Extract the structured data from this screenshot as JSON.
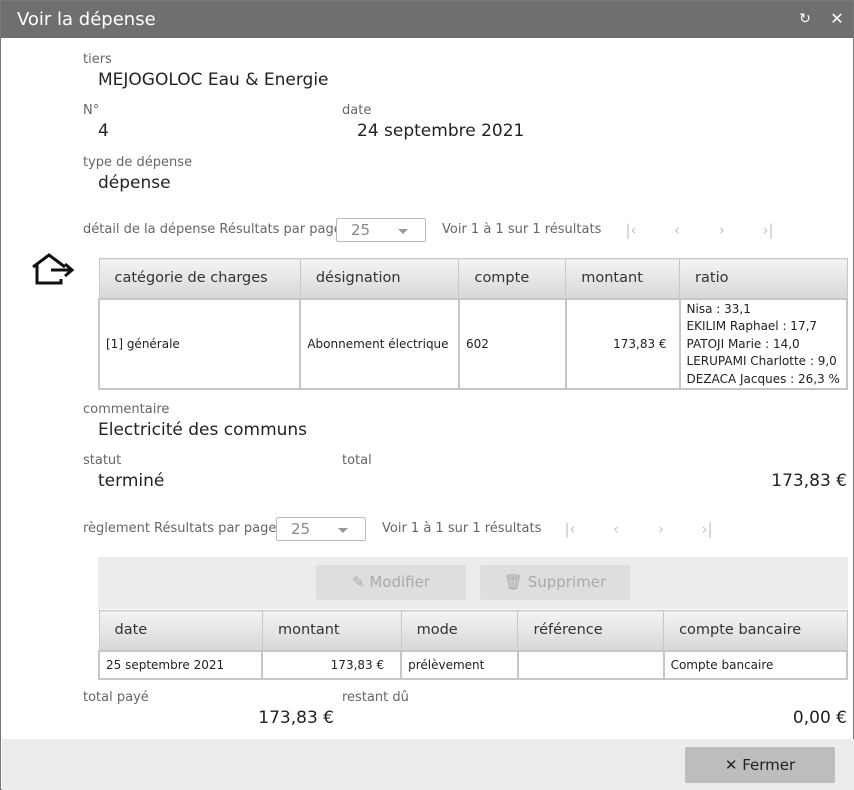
{
  "dialog": {
    "title": "Voir la dépense",
    "refresh_icon": "refresh-icon",
    "close_icon": "close-icon"
  },
  "fields": {
    "tiers_label": "tiers",
    "tiers_value": "MEJOGOLOC Eau & Energie",
    "numero_label": "N°",
    "numero_value": "4",
    "date_label": "date",
    "date_value": "24 septembre 2021",
    "type_label": "type de dépense",
    "type_value": "dépense",
    "commentaire_label": "commentaire",
    "commentaire_value": "Electricité des communs",
    "statut_label": "statut",
    "statut_value": "terminé",
    "total_label": "total",
    "total_value": "173,83 €",
    "total_paye_label": "total payé",
    "total_paye_value": "173,83 €",
    "restant_du_label": "restant dû",
    "restant_du_value": "0,00 €"
  },
  "detail": {
    "label": "détail de la dépense Résultats par page",
    "per_page": "25",
    "range_text": "Voir 1 à 1 sur 1 résultats",
    "columns": [
      "catégorie de charges",
      "désignation",
      "compte",
      "montant",
      "ratio"
    ],
    "rows": [
      {
        "categorie": "[1] générale",
        "designation": "Abonnement électrique",
        "compte": "602",
        "montant": "173,83 €",
        "ratio": [
          "Nisa : 33,1",
          "EKILIM Raphael : 17,7",
          "PATOJI Marie : 14,0",
          "LERUPAMI Charlotte : 9,0",
          "DEZACA Jacques : 26,3 %"
        ]
      }
    ]
  },
  "reglement": {
    "label": "règlement Résultats par page",
    "per_page": "25",
    "range_text": "Voir 1 à 1 sur 1 résultats",
    "modifier_label": "Modifier",
    "supprimer_label": "Supprimer",
    "columns": [
      "date",
      "montant",
      "mode",
      "référence",
      "compte bancaire"
    ],
    "rows": [
      {
        "date": "25 septembre 2021",
        "montant": "173,83 €",
        "mode": "prélèvement",
        "reference": "",
        "compte": "Compte bancaire"
      }
    ]
  },
  "footer": {
    "close_label": "Fermer"
  }
}
